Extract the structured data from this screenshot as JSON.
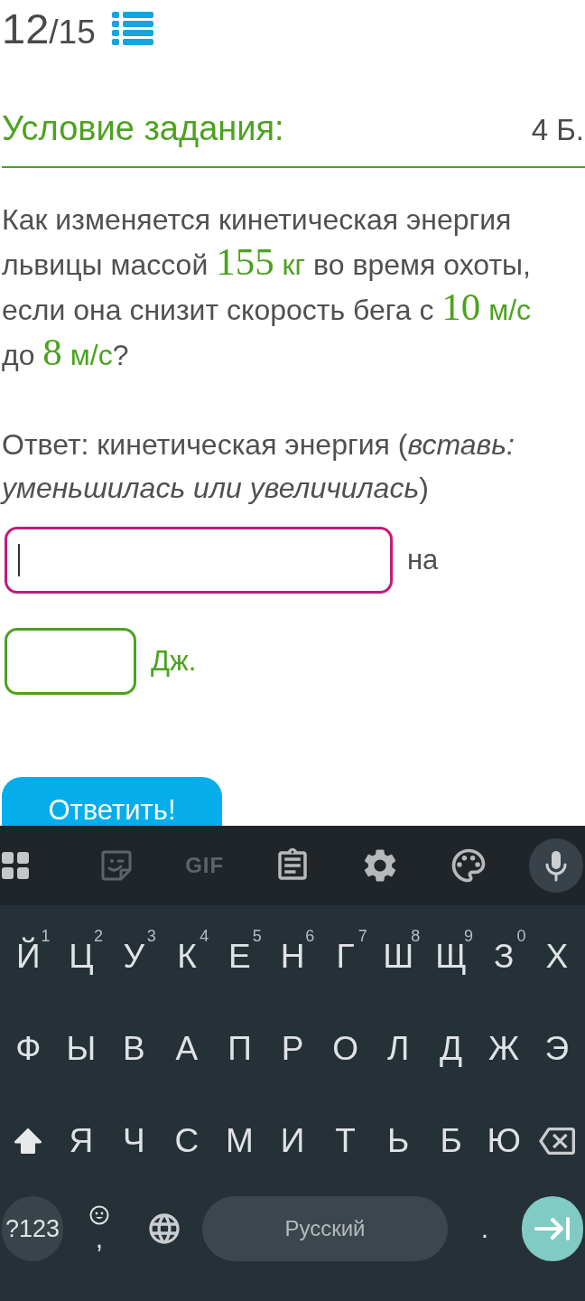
{
  "progress": {
    "current": "12",
    "total": "/15"
  },
  "task": {
    "title": "Условие задания:",
    "points": "4 Б."
  },
  "question": [
    {
      "kind": "text",
      "text": "Как изменяется кинетическая энергия львицы массой "
    },
    {
      "kind": "number",
      "text": "155"
    },
    {
      "kind": "unit",
      "text": " кг"
    },
    {
      "kind": "text",
      "text": " во время охоты, если она снизит скорость бега с "
    },
    {
      "kind": "number",
      "text": "10"
    },
    {
      "kind": "unit",
      "text": " м/с"
    },
    {
      "kind": "text",
      "text": " до "
    },
    {
      "kind": "number",
      "text": "8"
    },
    {
      "kind": "unit",
      "text": " м/с"
    },
    {
      "kind": "text",
      "text": "?"
    }
  ],
  "answer_prompt": "Ответ: кинетическая энергия (*вставь: уменьшилась или увеличилась*)",
  "answers": [
    {
      "kind": "wide",
      "focused": true,
      "suffix": {
        "kind": "text",
        "text": "на"
      }
    },
    {
      "kind": "narrow",
      "focused": false,
      "suffix": {
        "kind": "unit",
        "text": "Дж."
      }
    }
  ],
  "submit_button": {
    "label": "Ответить!"
  },
  "keyboard": {
    "toolbar": {
      "gif_label": "GIF"
    },
    "rows": [
      {
        "keys": [
          {
            "kind": "letter",
            "label": "Й",
            "hint": "1"
          },
          {
            "kind": "letter",
            "label": "Ц",
            "hint": "2"
          },
          {
            "kind": "letter",
            "label": "У",
            "hint": "3"
          },
          {
            "kind": "letter",
            "label": "К",
            "hint": "4"
          },
          {
            "kind": "letter",
            "label": "Е",
            "hint": "5"
          },
          {
            "kind": "letter",
            "label": "Н",
            "hint": "6"
          },
          {
            "kind": "letter",
            "label": "Г",
            "hint": "7"
          },
          {
            "kind": "letter",
            "label": "Ш",
            "hint": "8"
          },
          {
            "kind": "letter",
            "label": "Щ",
            "hint": "9"
          },
          {
            "kind": "letter",
            "label": "З",
            "hint": "0"
          },
          {
            "kind": "letter",
            "label": "Х"
          }
        ]
      },
      {
        "keys": [
          {
            "kind": "letter",
            "label": "Ф"
          },
          {
            "kind": "letter",
            "label": "Ы"
          },
          {
            "kind": "letter",
            "label": "В"
          },
          {
            "kind": "letter",
            "label": "А"
          },
          {
            "kind": "letter",
            "label": "П"
          },
          {
            "kind": "letter",
            "label": "Р"
          },
          {
            "kind": "letter",
            "label": "О"
          },
          {
            "kind": "letter",
            "label": "Л"
          },
          {
            "kind": "letter",
            "label": "Д"
          },
          {
            "kind": "letter",
            "label": "Ж"
          },
          {
            "kind": "letter",
            "label": "Э"
          }
        ]
      },
      {
        "keys": [
          {
            "kind": "shift",
            "on": true
          },
          {
            "kind": "letter",
            "label": "Я"
          },
          {
            "kind": "letter",
            "label": "Ч"
          },
          {
            "kind": "letter",
            "label": "С"
          },
          {
            "kind": "letter",
            "label": "М"
          },
          {
            "kind": "letter",
            "label": "И"
          },
          {
            "kind": "letter",
            "label": "Т"
          },
          {
            "kind": "letter",
            "label": "Ь"
          },
          {
            "kind": "letter",
            "label": "Б"
          },
          {
            "kind": "letter",
            "label": "Ю"
          },
          {
            "kind": "backspace"
          }
        ]
      },
      {
        "keys": [
          {
            "kind": "symbols",
            "label": "?123"
          },
          {
            "kind": "comma",
            "label": ","
          },
          {
            "kind": "globe"
          },
          {
            "kind": "space",
            "label": "Русский"
          },
          {
            "kind": "period",
            "label": "."
          },
          {
            "kind": "enter"
          }
        ]
      }
    ]
  }
}
